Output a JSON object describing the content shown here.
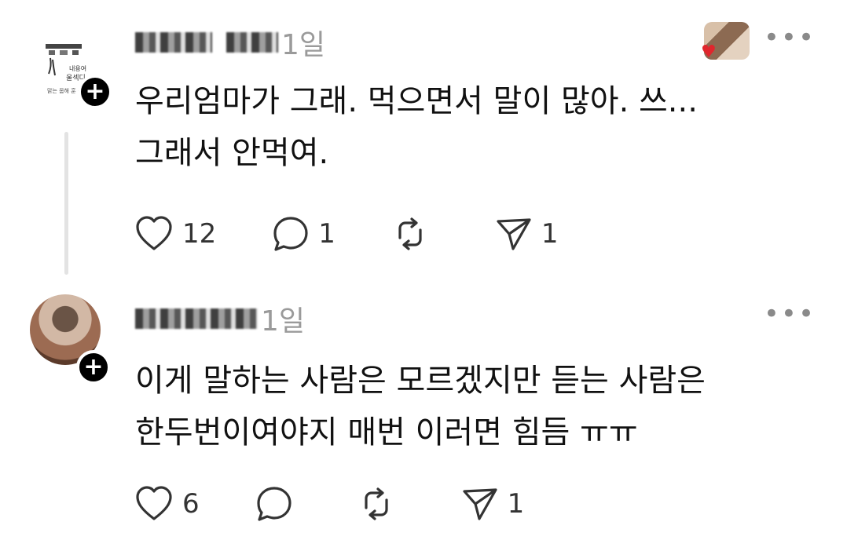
{
  "posts": [
    {
      "time": "1일",
      "text": "우리엄마가 그래. 먹으면서 말이 많아. 쓰...\n그래서 안먹여.",
      "likes": "12",
      "replies": "1",
      "reposts": "",
      "shares": "1",
      "avatar_icon": "calligraphy-avatar",
      "follow_icon": "plus-icon"
    },
    {
      "time": "1일",
      "text": "이게 말하는 사람은 모르겠지만 듣는 사람은\n한두번이여야지 매번 이러면 힘듬 ㅠㅠ",
      "likes": "6",
      "replies": "",
      "reposts": "",
      "shares": "1",
      "avatar_icon": "photo-avatar",
      "follow_icon": "plus-icon"
    }
  ],
  "ui": {
    "more_glyph": "•••",
    "plus_glyph": "+",
    "reply_thumb_icon": "heart-icon"
  },
  "colors": {
    "text": "#111111",
    "muted": "#9a9a9a",
    "icon": "#333333",
    "thread_line": "#e3e3e3",
    "like_heart": "#e0262d"
  }
}
